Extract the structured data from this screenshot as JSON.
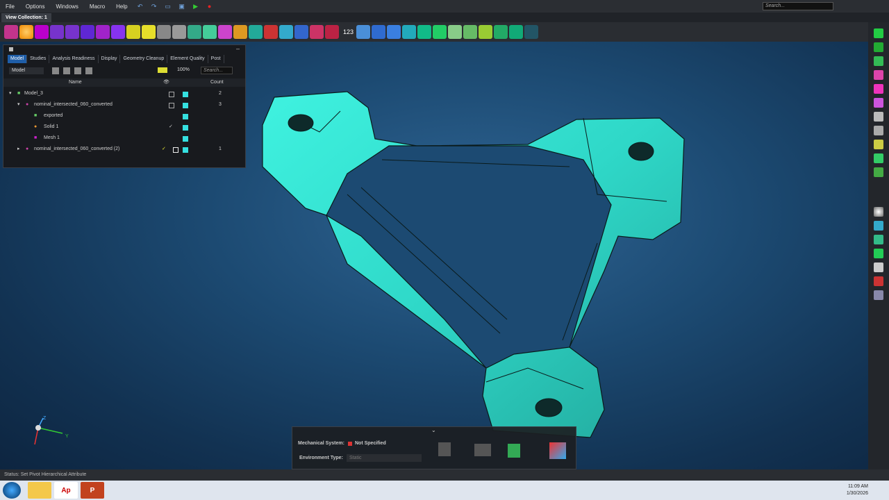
{
  "menubar": {
    "items": [
      "File",
      "Options",
      "Windows",
      "Macro",
      "Help"
    ],
    "search_placeholder": "Search..."
  },
  "view_tab": "View Collection: 1",
  "toolbar": {
    "counter": "123"
  },
  "model_browser": {
    "tabs": [
      "Model",
      "Studies",
      "Analysis Readiness",
      "Display",
      "Geometry Cleanup",
      "Element Quality",
      "Post"
    ],
    "mode": "Model",
    "zoom": "100%",
    "search_placeholder": "Search...",
    "columns": {
      "name": "Name",
      "count": "Count"
    },
    "rows": [
      {
        "name": "Model_3",
        "count": "2"
      },
      {
        "name": "nominal_intersected_060_converted",
        "count": "3"
      },
      {
        "name": "exported",
        "count": ""
      },
      {
        "name": "Solid 1",
        "count": ""
      },
      {
        "name": "Mesh 1",
        "count": ""
      },
      {
        "name": "nominal_intersected_060_converted (2)",
        "count": "1"
      }
    ]
  },
  "system_panel": {
    "mech_label": "Mechanical System:",
    "mech_value": "Not Specified",
    "env_label": "Environment Type:",
    "env_value": "Static"
  },
  "status_text": "Status:  Set Pivot Hierarchical Attribute",
  "clock": {
    "time": "11:09 AM",
    "date": "1/30/2026"
  },
  "axis": {
    "z": "Z",
    "y": "Y"
  },
  "colors": {
    "mesh": "#35e0d0",
    "viewport": "#1c4a72"
  }
}
